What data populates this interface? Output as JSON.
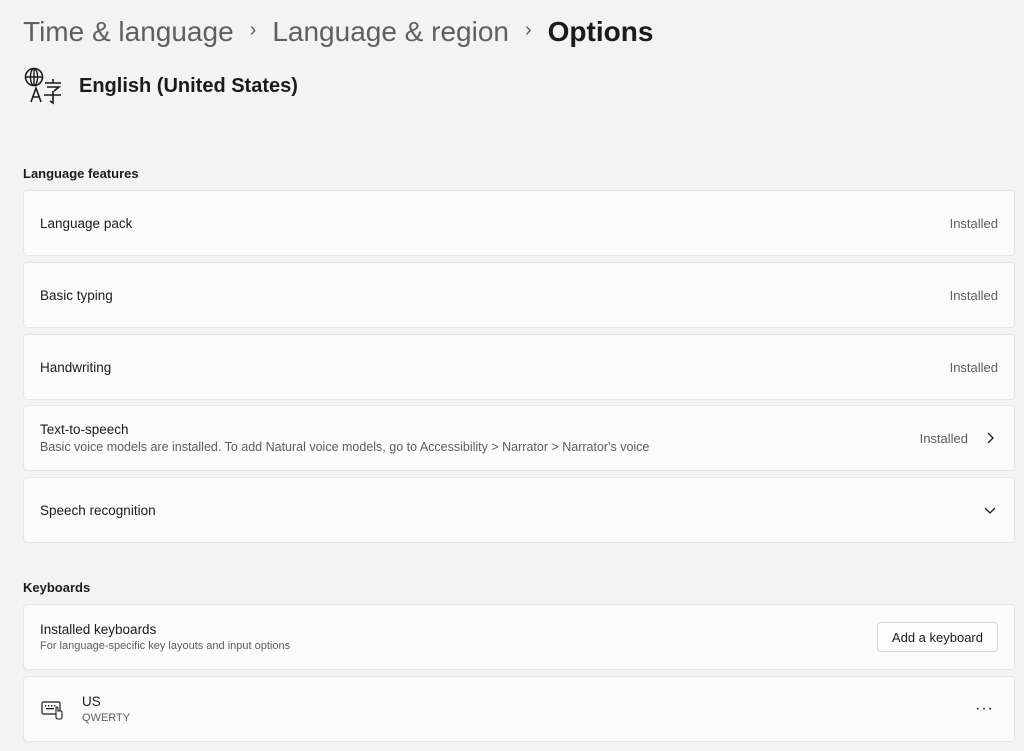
{
  "breadcrumb": {
    "items": [
      "Time & language",
      "Language & region"
    ],
    "current": "Options",
    "separator": "›"
  },
  "language": {
    "name": "English (United States)",
    "icon": "language-icon"
  },
  "sections": {
    "features_label": "Language features",
    "keyboards_label": "Keyboards"
  },
  "features": [
    {
      "title": "Language pack",
      "status": "Installed"
    },
    {
      "title": "Basic typing",
      "status": "Installed"
    },
    {
      "title": "Handwriting",
      "status": "Installed"
    },
    {
      "title": "Text-to-speech",
      "subtitle": "Basic voice models are installed. To add Natural voice models, go to Accessibility > Narrator > Narrator's voice",
      "status": "Installed",
      "icon": "chevron-right-icon"
    },
    {
      "title": "Speech recognition",
      "icon": "chevron-down-icon"
    }
  ],
  "keyboards": {
    "installed_title": "Installed keyboards",
    "installed_subtitle": "For language-specific key layouts and input options",
    "add_button": "Add a keyboard",
    "items": [
      {
        "name": "US",
        "layout": "QWERTY",
        "icon": "keyboard-icon",
        "more": "···"
      }
    ]
  }
}
